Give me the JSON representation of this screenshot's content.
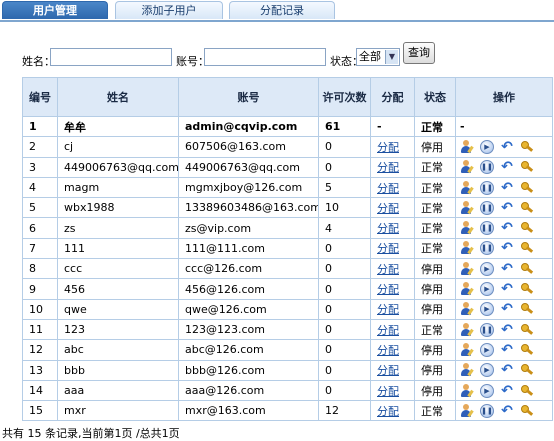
{
  "tabs": [
    {
      "label": "用户管理",
      "active": true
    },
    {
      "label": "添加子用户",
      "active": false
    },
    {
      "label": "分配记录",
      "active": false
    }
  ],
  "filter": {
    "name_label": "姓名：",
    "name_value": "",
    "account_label": "账号：",
    "account_value": "",
    "status_label": "状态：",
    "status_value": "全部",
    "query_button": "查询"
  },
  "table": {
    "headers": [
      "编号",
      "姓名",
      "账号",
      "许可次数",
      "分配",
      "状态",
      "操作"
    ],
    "rows": [
      {
        "id": "1",
        "name": "牟牟",
        "account": "admin@cqvip.com",
        "count": "61",
        "assign": "-",
        "status": "正常",
        "ops": "-"
      },
      {
        "id": "2",
        "name": "cj",
        "account": "607506@163.com",
        "count": "0",
        "assign": "分配",
        "status": "停用",
        "ops": "icons"
      },
      {
        "id": "3",
        "name": "449006763@qq.com",
        "account": "449006763@qq.com",
        "count": "0",
        "assign": "分配",
        "status": "正常",
        "ops": "icons"
      },
      {
        "id": "4",
        "name": "magm",
        "account": "mgmxjboy@126.com",
        "count": "5",
        "assign": "分配",
        "status": "正常",
        "ops": "icons"
      },
      {
        "id": "5",
        "name": "wbx1988",
        "account": "13389603486@163.com",
        "count": "10",
        "assign": "分配",
        "status": "正常",
        "ops": "icons"
      },
      {
        "id": "6",
        "name": "zs",
        "account": "zs@vip.com",
        "count": "4",
        "assign": "分配",
        "status": "正常",
        "ops": "icons"
      },
      {
        "id": "7",
        "name": "111",
        "account": "111@111.com",
        "count": "0",
        "assign": "分配",
        "status": "正常",
        "ops": "icons"
      },
      {
        "id": "8",
        "name": "ccc",
        "account": "ccc@126.com",
        "count": "0",
        "assign": "分配",
        "status": "停用",
        "ops": "icons"
      },
      {
        "id": "9",
        "name": "456",
        "account": "456@126.com",
        "count": "0",
        "assign": "分配",
        "status": "停用",
        "ops": "icons"
      },
      {
        "id": "10",
        "name": "qwe",
        "account": "qwe@126.com",
        "count": "0",
        "assign": "分配",
        "status": "停用",
        "ops": "icons"
      },
      {
        "id": "11",
        "name": "123",
        "account": "123@123.com",
        "count": "0",
        "assign": "分配",
        "status": "正常",
        "ops": "icons"
      },
      {
        "id": "12",
        "name": "abc",
        "account": "abc@126.com",
        "count": "0",
        "assign": "分配",
        "status": "停用",
        "ops": "icons"
      },
      {
        "id": "13",
        "name": "bbb",
        "account": "bbb@126.com",
        "count": "0",
        "assign": "分配",
        "status": "停用",
        "ops": "icons"
      },
      {
        "id": "14",
        "name": "aaa",
        "account": "aaa@126.com",
        "count": "0",
        "assign": "分配",
        "status": "停用",
        "ops": "icons"
      },
      {
        "id": "15",
        "name": "mxr",
        "account": "mxr@163.com",
        "count": "12",
        "assign": "分配",
        "status": "正常",
        "ops": "icons"
      }
    ],
    "op_icons": [
      "user-edit-icon",
      "play-pause-icon",
      "undo-icon",
      "key-icon"
    ]
  },
  "footer": "共有  15 条记录,当前第1页  /总共1页"
}
